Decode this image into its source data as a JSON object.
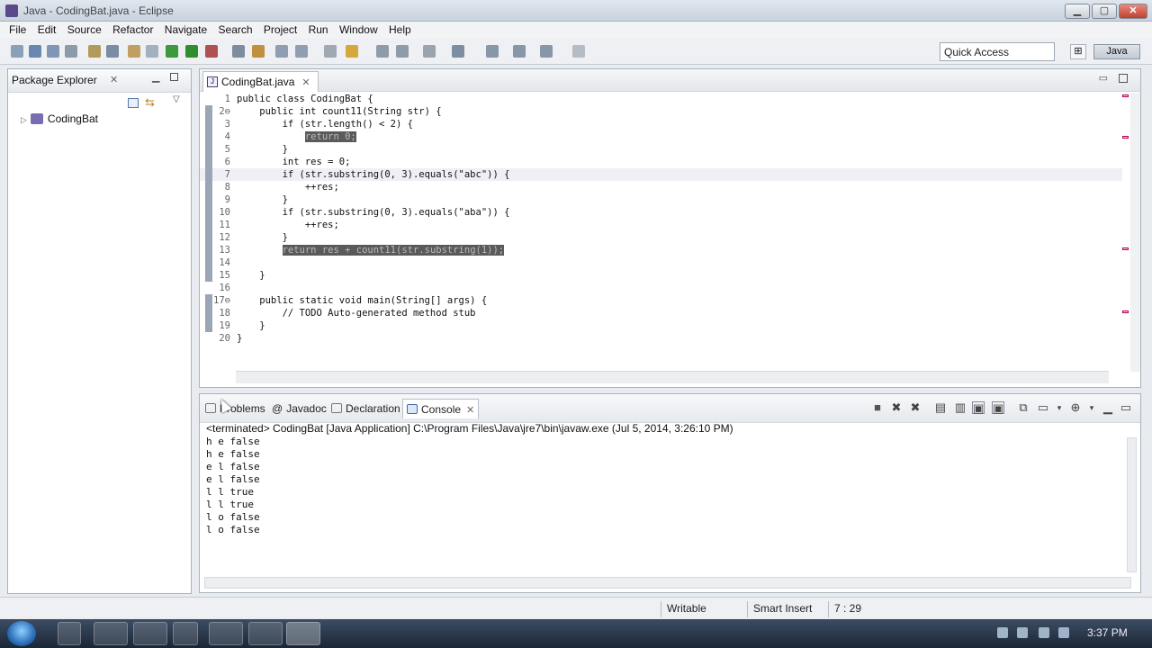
{
  "window": {
    "title": "Java - CodingBat.java - Eclipse"
  },
  "menu": [
    "File",
    "Edit",
    "Source",
    "Refactor",
    "Navigate",
    "Search",
    "Project",
    "Run",
    "Window",
    "Help"
  ],
  "toolbar": {
    "quick_access": "Quick Access",
    "perspective": "Java"
  },
  "package_explorer": {
    "title": "Package Explorer",
    "project": "CodingBat"
  },
  "editor": {
    "tab": "CodingBat.java",
    "lines": [
      {
        "n": "1",
        "code": "public class CodingBat {"
      },
      {
        "n": "2⊖",
        "code": "    public int count11(String str) {"
      },
      {
        "n": "3",
        "code": "        if (str.length() < 2) {"
      },
      {
        "n": "4",
        "code": "            return 0;"
      },
      {
        "n": "5",
        "code": "        }"
      },
      {
        "n": "6",
        "code": "        int res = 0;"
      },
      {
        "n": "7",
        "code": "        if (str.substring(0, 3).equals(\"abc\")) {"
      },
      {
        "n": "8",
        "code": "            ++res;"
      },
      {
        "n": "9",
        "code": "        }"
      },
      {
        "n": "10",
        "code": "        if (str.substring(0, 3).equals(\"aba\")) {"
      },
      {
        "n": "11",
        "code": "            ++res;"
      },
      {
        "n": "12",
        "code": "        }"
      },
      {
        "n": "13",
        "code": "        return res + count11(str.substring(1));"
      },
      {
        "n": "14",
        "code": ""
      },
      {
        "n": "15",
        "code": "    }"
      },
      {
        "n": "16",
        "code": ""
      },
      {
        "n": "17⊖",
        "code": "    public static void main(String[] args) {"
      },
      {
        "n": "18",
        "code": "        // TODO Auto-generated method stub"
      },
      {
        "n": "19",
        "code": "    }"
      },
      {
        "n": "20",
        "code": "}"
      }
    ]
  },
  "console": {
    "tabs": [
      "Problems",
      "Javadoc",
      "Declaration",
      "Console"
    ],
    "status": "<terminated> CodingBat [Java Application] C:\\Program Files\\Java\\jre7\\bin\\javaw.exe (Jul 5, 2014, 3:26:10 PM)",
    "output": [
      "h e false",
      "h e false",
      "e l false",
      "e l false",
      "l l true",
      "l l true",
      "l o false",
      "l o false"
    ]
  },
  "statusbar": {
    "writable": "Writable",
    "insert_mode": "Smart Insert",
    "position": "7 : 29"
  },
  "taskbar": {
    "clock": "3:37 PM"
  }
}
